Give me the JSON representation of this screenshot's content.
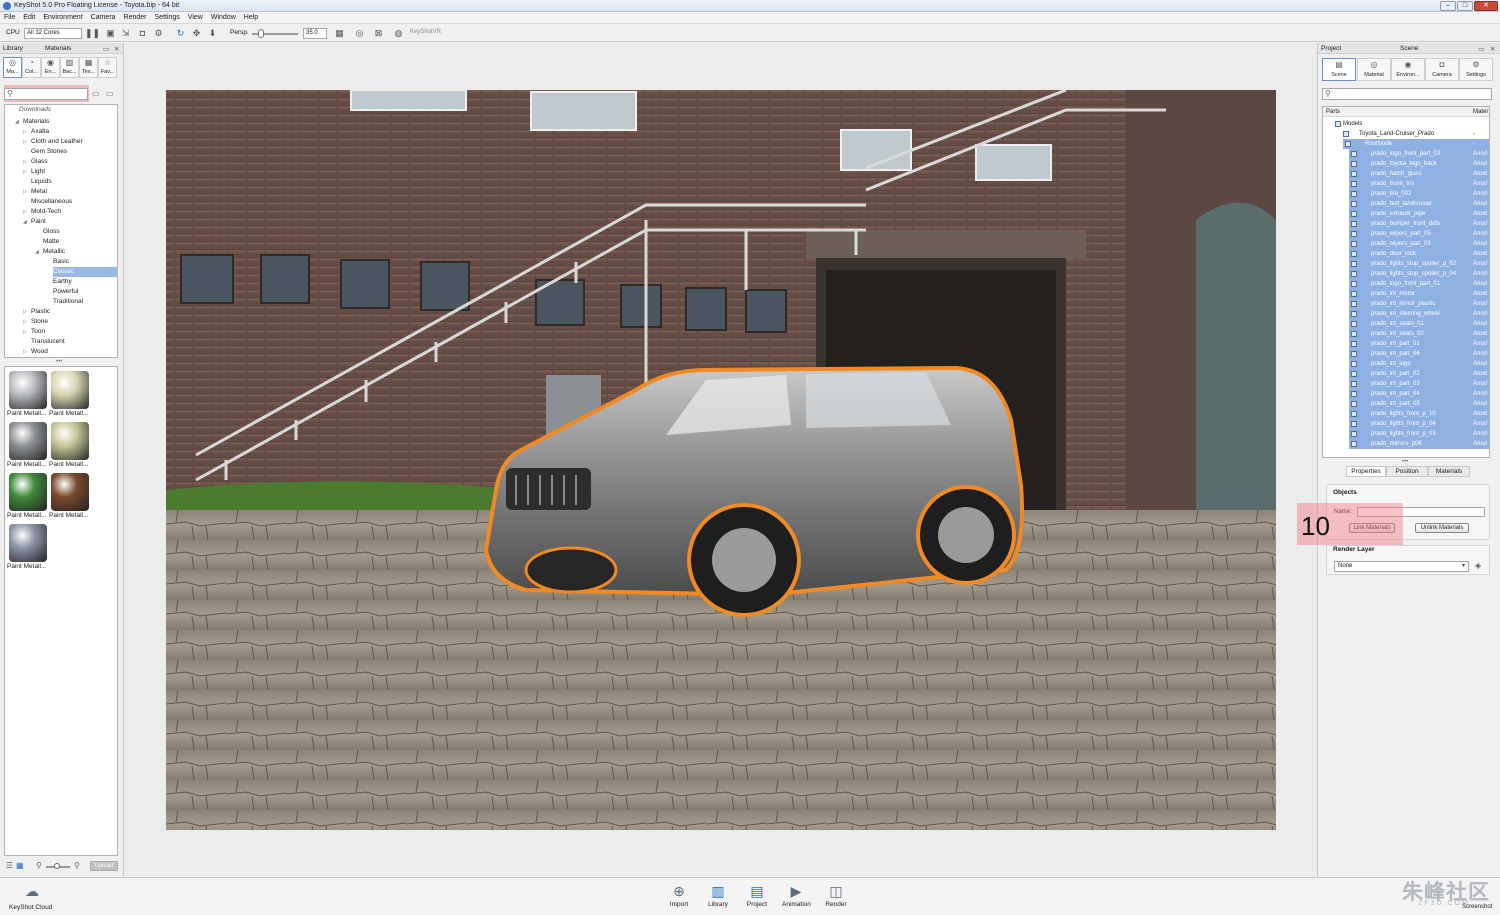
{
  "window": {
    "title": "KeyShot 5.0 Pro Floating License  -  Toyota.bip  -  64 bit",
    "controls": [
      "–",
      "□",
      "✕"
    ]
  },
  "menu": [
    "File",
    "Edit",
    "Environment",
    "Camera",
    "Render",
    "Settings",
    "View",
    "Window",
    "Help"
  ],
  "toolbar": {
    "cpu_label": "CPU",
    "cores_select": "All 32 Cores",
    "projection_label": "Persp.",
    "fov_value": "35.0",
    "keyshotvr_label": "KeyShotVR"
  },
  "library": {
    "panel_label": "Library",
    "panel_title": "Materials",
    "tabs": [
      "Ma...",
      "Col...",
      "En...",
      "Bac...",
      "Tex...",
      "Fav..."
    ],
    "search_placeholder": "",
    "tree_root": "Downloads",
    "tree": [
      {
        "label": "Materials",
        "depth": 0,
        "arrow": "◢"
      },
      {
        "label": "Axalta",
        "depth": 1,
        "arrow": "▷"
      },
      {
        "label": "Cloth and Leather",
        "depth": 1,
        "arrow": "▷"
      },
      {
        "label": "Gem Stones",
        "depth": 1,
        "arrow": ""
      },
      {
        "label": "Glass",
        "depth": 1,
        "arrow": "▷"
      },
      {
        "label": "Light",
        "depth": 1,
        "arrow": "▷"
      },
      {
        "label": "Liquids",
        "depth": 1,
        "arrow": ""
      },
      {
        "label": "Metal",
        "depth": 1,
        "arrow": "▷"
      },
      {
        "label": "Miscellaneous",
        "depth": 1,
        "arrow": ""
      },
      {
        "label": "Mold-Tech",
        "depth": 1,
        "arrow": "▷"
      },
      {
        "label": "Paint",
        "depth": 1,
        "arrow": "◢"
      },
      {
        "label": "Gloss",
        "depth": 2,
        "arrow": ""
      },
      {
        "label": "Matte",
        "depth": 2,
        "arrow": ""
      },
      {
        "label": "Metallic",
        "depth": 2,
        "arrow": "◢"
      },
      {
        "label": "Basic",
        "depth": 3,
        "arrow": ""
      },
      {
        "label": "Classic",
        "depth": 3,
        "arrow": "",
        "selected": true
      },
      {
        "label": "Earthy",
        "depth": 3,
        "arrow": ""
      },
      {
        "label": "Powerful",
        "depth": 3,
        "arrow": ""
      },
      {
        "label": "Traditional",
        "depth": 3,
        "arrow": ""
      },
      {
        "label": "Plastic",
        "depth": 1,
        "arrow": "▷"
      },
      {
        "label": "Stone",
        "depth": 1,
        "arrow": "▷"
      },
      {
        "label": "Toon",
        "depth": 1,
        "arrow": "▷"
      },
      {
        "label": "Translucent",
        "depth": 1,
        "arrow": ""
      },
      {
        "label": "Wood",
        "depth": 1,
        "arrow": "▷"
      }
    ],
    "thumbnails": [
      {
        "label": "Paint Metall...",
        "color": "#b9bcc0"
      },
      {
        "label": "Paint Metall...",
        "color": "#d9d6b3"
      },
      {
        "label": "Paint Metall...",
        "color": "#8f9296"
      },
      {
        "label": "Paint Metall...",
        "color": "#c7c79a"
      },
      {
        "label": "Paint Metall...",
        "color": "#3f8a3a"
      },
      {
        "label": "Paint Metall...",
        "color": "#7a4a2c"
      },
      {
        "label": "Paint Metall...",
        "color": "#8d93a6"
      }
    ],
    "upload_label": "Upload"
  },
  "project": {
    "panel_label": "Project",
    "panel_title": "Scene",
    "tabs": [
      "Scene",
      "Material",
      "Environ...",
      "Camera",
      "Settings"
    ],
    "search_placeholder": "",
    "parts_header": "Parts",
    "material_header": "Mater",
    "tree": [
      {
        "label": "Models",
        "depth": 0,
        "selected": false,
        "mat": ""
      },
      {
        "label": "Toyota_Land-Cruiser_Prado",
        "depth": 1,
        "selected": false,
        "mat": "-"
      },
      {
        "label": "RootNode",
        "depth": 2,
        "selected": true,
        "mat": "-"
      },
      {
        "label": "prado_logo_front_part_03",
        "depth": 3,
        "selected": true,
        "mat": "Anod"
      },
      {
        "label": "prado_toyota_logo_back",
        "depth": 3,
        "selected": true,
        "mat": "Anod"
      },
      {
        "label": "prado_hatch_glass",
        "depth": 3,
        "selected": true,
        "mat": "Anod"
      },
      {
        "label": "prado_trunk_tris",
        "depth": 3,
        "selected": true,
        "mat": "Anod"
      },
      {
        "label": "prado_tire_002",
        "depth": 3,
        "selected": true,
        "mat": "Anod"
      },
      {
        "label": "prado_text_landcruiser",
        "depth": 3,
        "selected": true,
        "mat": "Anod"
      },
      {
        "label": "prado_exhaust_pipe",
        "depth": 3,
        "selected": true,
        "mat": "Anod"
      },
      {
        "label": "prado_bumper_front_dots",
        "depth": 3,
        "selected": true,
        "mat": "Anod"
      },
      {
        "label": "prado_wipers_part_05",
        "depth": 3,
        "selected": true,
        "mat": "Anod"
      },
      {
        "label": "prado_wipers_part_03",
        "depth": 3,
        "selected": true,
        "mat": "Anod"
      },
      {
        "label": "prado_door_lock",
        "depth": 3,
        "selected": true,
        "mat": "Anod"
      },
      {
        "label": "prado_lights_stop_spoiler_p_02",
        "depth": 3,
        "selected": true,
        "mat": "Anod"
      },
      {
        "label": "prado_lights_stop_spoiler_p_04",
        "depth": 3,
        "selected": true,
        "mat": "Anod"
      },
      {
        "label": "prado_logo_front_part_01",
        "depth": 3,
        "selected": true,
        "mat": "Anod"
      },
      {
        "label": "prado_int_mirror",
        "depth": 3,
        "selected": true,
        "mat": "Anod"
      },
      {
        "label": "prado_int_mirror_plastic",
        "depth": 3,
        "selected": true,
        "mat": "Anod"
      },
      {
        "label": "prado_int_steering_wheel",
        "depth": 3,
        "selected": true,
        "mat": "Anod"
      },
      {
        "label": "prado_int_seats_01",
        "depth": 3,
        "selected": true,
        "mat": "Anod"
      },
      {
        "label": "prado_int_seats_02",
        "depth": 3,
        "selected": true,
        "mat": "Anod"
      },
      {
        "label": "prado_int_part_01",
        "depth": 3,
        "selected": true,
        "mat": "Anod"
      },
      {
        "label": "prado_int_part_06",
        "depth": 3,
        "selected": true,
        "mat": "Anod"
      },
      {
        "label": "prado_int_logo",
        "depth": 3,
        "selected": true,
        "mat": "Anod"
      },
      {
        "label": "prado_int_part_02",
        "depth": 3,
        "selected": true,
        "mat": "Anod"
      },
      {
        "label": "prado_int_part_03",
        "depth": 3,
        "selected": true,
        "mat": "Anod"
      },
      {
        "label": "prado_int_part_04",
        "depth": 3,
        "selected": true,
        "mat": "Anod"
      },
      {
        "label": "prado_int_part_05",
        "depth": 3,
        "selected": true,
        "mat": "Anod"
      },
      {
        "label": "prado_lights_front_p_10",
        "depth": 3,
        "selected": true,
        "mat": "Anod"
      },
      {
        "label": "prado_lights_front_p_04",
        "depth": 3,
        "selected": true,
        "mat": "Anod"
      },
      {
        "label": "prado_lights_front_p_03",
        "depth": 3,
        "selected": true,
        "mat": "Anod"
      },
      {
        "label": "prado_mirrors_p06",
        "depth": 3,
        "selected": true,
        "mat": "Anod"
      }
    ],
    "subtabs": [
      "Properties",
      "Position",
      "Materials"
    ],
    "objects_title": "Objects",
    "name_label": "Name:",
    "name_value": "",
    "link_button": "Link Materials",
    "unlink_button": "Unlink Materials",
    "render_layer_title": "Render Layer",
    "render_layer_value": "None",
    "step_number": "10"
  },
  "bottombar": {
    "cloud_label": "KeyShot Cloud",
    "items": [
      "Import",
      "Library",
      "Project",
      "Animation",
      "Render"
    ],
    "screenshot_label": "Screenshot",
    "watermark_text": "朱峰社区",
    "watermark_sub": "ZF3D.COM"
  },
  "colors": {
    "selection": "#8fb0e3",
    "highlight": "#f07882",
    "outline": "#f08a24"
  }
}
